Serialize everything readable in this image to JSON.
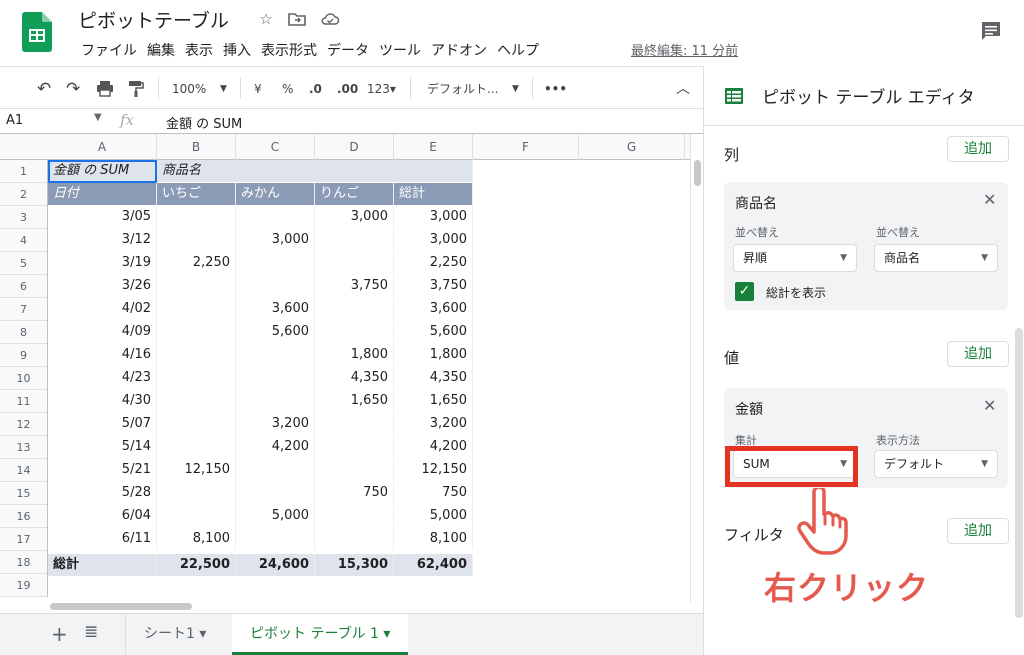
{
  "header": {
    "title": "ピボットテーブル",
    "menu": [
      "ファイル",
      "編集",
      "表示",
      "挿入",
      "表示形式",
      "データ",
      "ツール",
      "アドオン",
      "ヘルプ"
    ],
    "last_edit": "最終編集: 11 分前"
  },
  "toolbar": {
    "zoom": "100%",
    "currency": "¥",
    "percent": "%",
    "dec_decrease": ".0",
    "dec_increase": ".00",
    "format_123": "123▾",
    "font": "デフォルト..."
  },
  "formula_bar": {
    "name_box": "A1",
    "fx": "fx",
    "content": "金額 の SUM"
  },
  "grid": {
    "columns": [
      "A",
      "B",
      "C",
      "D",
      "E",
      "F",
      "G"
    ],
    "rows": [
      "1",
      "2",
      "3",
      "4",
      "5",
      "6",
      "7",
      "8",
      "9",
      "10",
      "11",
      "12",
      "13",
      "14",
      "15",
      "16",
      "17",
      "18",
      "19"
    ],
    "header_row1": [
      "金額 の SUM",
      "商品名"
    ],
    "header_row2": [
      "日付",
      "いちご",
      "みかん",
      "りんご",
      "総計"
    ],
    "data": [
      [
        "3/05",
        "",
        "",
        "3,000",
        "3,000"
      ],
      [
        "3/12",
        "",
        "3,000",
        "",
        "3,000"
      ],
      [
        "3/19",
        "2,250",
        "",
        "",
        "2,250"
      ],
      [
        "3/26",
        "",
        "",
        "3,750",
        "3,750"
      ],
      [
        "4/02",
        "",
        "3,600",
        "",
        "3,600"
      ],
      [
        "4/09",
        "",
        "5,600",
        "",
        "5,600"
      ],
      [
        "4/16",
        "",
        "",
        "1,800",
        "1,800"
      ],
      [
        "4/23",
        "",
        "",
        "4,350",
        "4,350"
      ],
      [
        "4/30",
        "",
        "",
        "1,650",
        "1,650"
      ],
      [
        "5/07",
        "",
        "3,200",
        "",
        "3,200"
      ],
      [
        "5/14",
        "",
        "4,200",
        "",
        "4,200"
      ],
      [
        "5/21",
        "12,150",
        "",
        "",
        "12,150"
      ],
      [
        "5/28",
        "",
        "",
        "750",
        "750"
      ],
      [
        "6/04",
        "",
        "5,000",
        "",
        "5,000"
      ],
      [
        "6/11",
        "8,100",
        "",
        "",
        "8,100"
      ]
    ],
    "total_row": [
      "総計",
      "22,500",
      "24,600",
      "15,300",
      "62,400"
    ]
  },
  "sheets": {
    "tabs": [
      "シート1 ▾",
      "ピボット テーブル 1 ▾"
    ],
    "active": 1
  },
  "panel": {
    "title": "ピボット テーブル エディタ",
    "columns_label": "列",
    "add_label": "追加",
    "col_card": {
      "title": "商品名",
      "sort_label": "並べ替え",
      "sort_value": "昇順",
      "sortby_label": "並べ替え",
      "sortby_value": "商品名",
      "show_total": "総計を表示"
    },
    "values_label": "値",
    "val_card": {
      "title": "金額",
      "summarize_label": "集計",
      "summarize_value": "SUM",
      "show_as_label": "表示方法",
      "show_as_value": "デフォルト"
    },
    "filters_label": "フィルタ"
  },
  "annotation": {
    "text": "右クリック",
    "color": "#e53323"
  },
  "colors": {
    "accent_green": "#188038",
    "header_light": "#dfe3ec",
    "header_dark": "#8c9bb5",
    "selection_blue": "#1a73e8"
  }
}
